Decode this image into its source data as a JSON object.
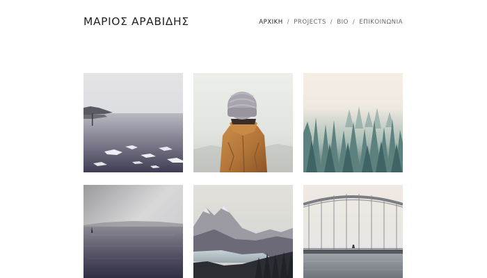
{
  "header": {
    "site_title": "ΜΑΡΙΟΣ ΑΡΑΒΙΔΗΣ"
  },
  "nav": {
    "items": [
      {
        "label": "ΑΡΧΙΚΗ",
        "active": true
      },
      {
        "label": "PROJECTS",
        "active": false
      },
      {
        "label": "BIO",
        "active": false
      },
      {
        "label": "ΕΠΙΚΟΙΝΩΝΙΑ",
        "active": false
      }
    ],
    "separator": "/"
  },
  "gallery": {
    "items": [
      {
        "subject": "misty-shoreline"
      },
      {
        "subject": "person-in-beanie"
      },
      {
        "subject": "foggy-forest"
      },
      {
        "subject": "calm-sea-sailboat"
      },
      {
        "subject": "mountain-lake"
      },
      {
        "subject": "arch-bridge"
      }
    ]
  },
  "colors": {
    "text_primary": "#222222",
    "text_nav": "#666666",
    "background": "#ffffff"
  }
}
